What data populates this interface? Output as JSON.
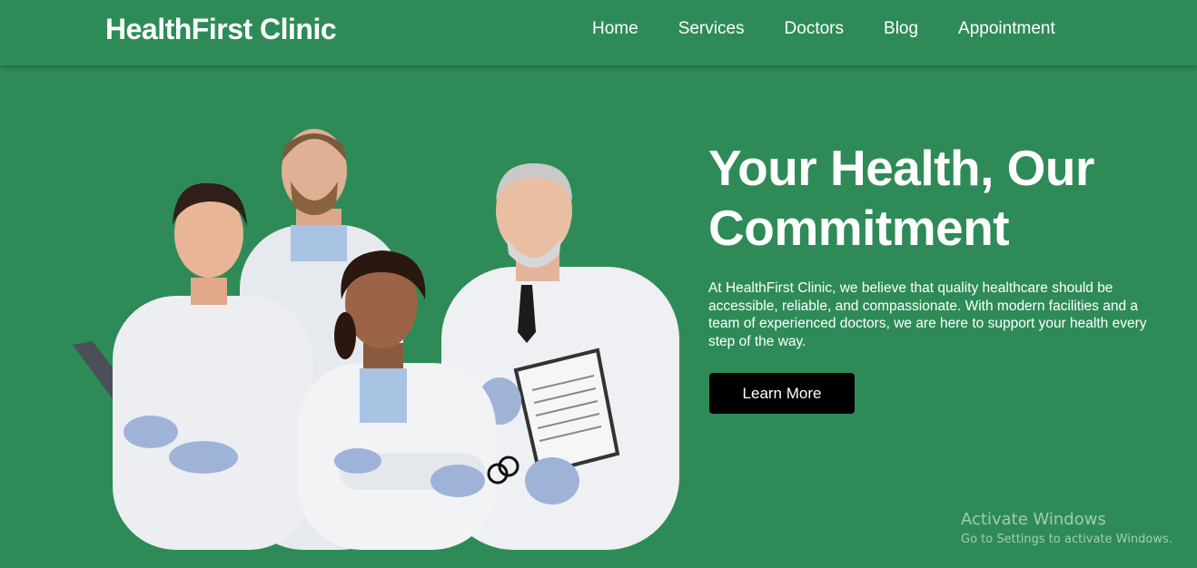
{
  "navbar": {
    "brand": "HealthFirst Clinic",
    "links": [
      "Home",
      "Services",
      "Doctors",
      "Blog",
      "Appointment"
    ]
  },
  "hero": {
    "title_line1": "Your Health, Our",
    "title_line2": "Commitment",
    "description": "At HealthFirst Clinic, we believe that quality healthcare should be accessible, reliable, and compassionate. With modern facilities and a team of experienced doctors, we are here to support your health every step of the way.",
    "button_label": "Learn More",
    "image_icon": "doctors-team-photo"
  },
  "watermark": {
    "title": "Activate Windows",
    "subtitle": "Go to Settings to activate Windows."
  },
  "colors": {
    "background": "#2e8b57",
    "text": "#ffffff",
    "button": "#000000"
  }
}
